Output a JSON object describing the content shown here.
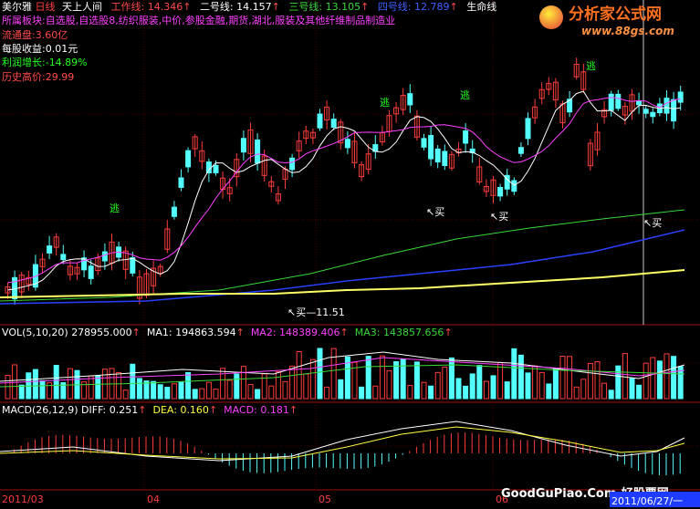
{
  "header": {
    "stock_name": "美尔雅",
    "period": "日线",
    "formula_name": "天上人间",
    "line1": {
      "label": "工作线:",
      "value": "14.346",
      "arrow": "↑"
    },
    "line2": {
      "label": "二号线:",
      "value": "14.157",
      "arrow": "↑"
    },
    "line3": {
      "label": "三号线:",
      "value": "13.105",
      "arrow": "↑"
    },
    "line4": {
      "label": "四号线:",
      "value": "12.789",
      "arrow": "↑"
    },
    "line5": {
      "label": "生命线"
    }
  },
  "info": {
    "sector_label": "所属板块:",
    "sector_value": "自选股,自选股8,纺织服装,中价,参股金融,期货,湖北,服装及其他纤维制品制造业",
    "float_label": "流通盘:",
    "float_value": "3.60亿",
    "eps_label": "每股收益:",
    "eps_value": "0.01元",
    "profit_label": "利润增长:",
    "profit_value": "-14.89%",
    "high_label": "历史高价:",
    "high_value": "29.99"
  },
  "signals": {
    "escape": "逃",
    "buy": "买",
    "low_price": "11.51"
  },
  "volume": {
    "title": "VOL(5,10,20)",
    "value": "278955.000",
    "ma1": "MA1: 194863.594",
    "ma2": "MA2: 148389.406",
    "ma3": "MA3: 143857.656",
    "arrow": "↑"
  },
  "macd": {
    "title": "MACD(26,12,9)",
    "diff": "DIFF: 0.251",
    "dea": "DEA: 0.160",
    "macd": "MACD: 0.181",
    "arrow": "↑"
  },
  "xaxis": {
    "d1": "2011/03",
    "d2": "04",
    "d3": "05",
    "d4": "06",
    "current": "2011/06/27/一"
  },
  "watermark": {
    "brand": "分析家公式网",
    "url": "www.88gs.com",
    "footer": "GoodGuPiao.Com-好股票网"
  },
  "colors": {
    "up": "#ff3d3d",
    "down": "#54ffff",
    "ma1": "#ffffff",
    "ma2": "#ff40ff",
    "ma3": "#38d838",
    "ma4": "#2a40ff",
    "life": "#ffff66",
    "label": "#ff4b4b",
    "green_text": "#20ff20",
    "yellow_text": "#ffff40",
    "magenta_text": "#ff40ff"
  }
}
